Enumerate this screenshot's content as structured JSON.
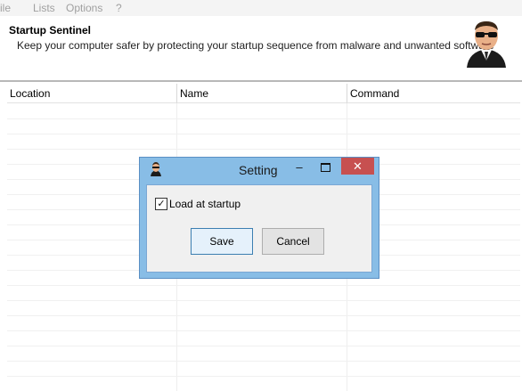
{
  "menubar": {
    "items": [
      "ile",
      "Lists",
      "Options",
      "?"
    ]
  },
  "header": {
    "title": "Startup Sentinel",
    "subtitle": "Keep your computer safer by protecting your startup sequence from malware and unwanted software"
  },
  "table": {
    "columns": [
      "Location",
      "Name",
      "Command"
    ]
  },
  "dialog": {
    "title": "Setting",
    "minimize_glyph": "–",
    "close_glyph": "✕",
    "checkbox": {
      "label": "Load at startup",
      "checked": true,
      "mark": "✓"
    },
    "save_label": "Save",
    "cancel_label": "Cancel"
  },
  "colors": {
    "dialog_frame": "#88bde6",
    "close_button": "#c75050",
    "primary_border": "#3c7fb1"
  },
  "icons": {
    "app": "agent-avatar-icon",
    "dialog": "agent-small-icon"
  }
}
